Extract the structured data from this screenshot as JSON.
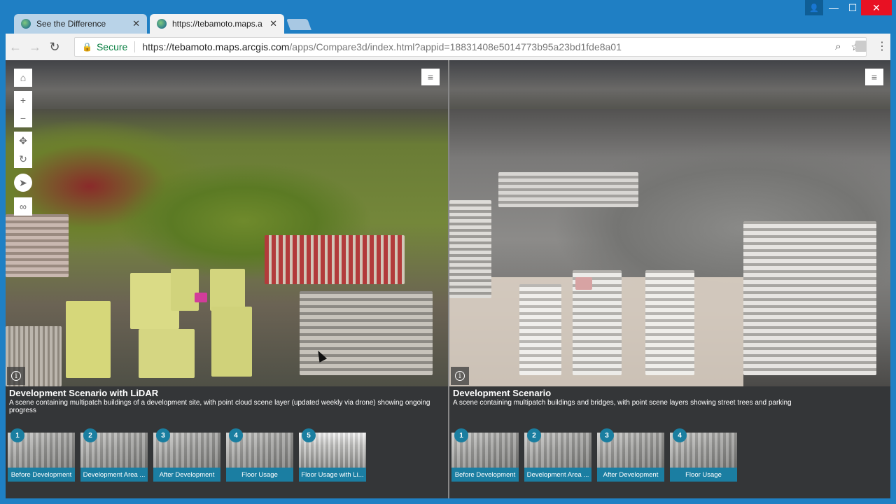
{
  "browser": {
    "tabs": [
      {
        "title": "See the Difference",
        "close": "✕"
      },
      {
        "title": "https://tebamoto.maps.a",
        "close": "✕"
      }
    ],
    "window_controls": {
      "user": "👤",
      "minimize": "—",
      "maximize": "☐",
      "close": "✕"
    },
    "nav": {
      "back": "←",
      "forward": "→",
      "reload": "↻"
    },
    "address": {
      "secure_label": "Secure",
      "scheme": "https://",
      "host": "tebamoto.maps.arcgis.com",
      "path": "/apps/Compare3d/index.html?appid=18831408e5014773b95a23bd1fde8a01"
    },
    "icons": {
      "lock": "lock-icon",
      "zoom": "magnifier-icon",
      "star": "star-icon",
      "menu": "kebab-menu-icon"
    }
  },
  "map_controls": {
    "home": "⌂",
    "zoom_in": "+",
    "zoom_out": "−",
    "pan": "✥",
    "rotate": "↻",
    "compass": "➤",
    "vr": "∞",
    "layer_list": "≡",
    "info": "i"
  },
  "left_pane": {
    "title": "Development Scenario with LiDAR",
    "description": "A scene containing multipatch buildings of a development site, with point cloud scene layer (updated weekly via drone) showing ongoing progress",
    "slides": [
      {
        "number": "1",
        "label": "Before Development"
      },
      {
        "number": "2",
        "label": "Development Area ..."
      },
      {
        "number": "3",
        "label": "After Development"
      },
      {
        "number": "4",
        "label": "Floor Usage"
      },
      {
        "number": "5",
        "label": "Floor Usage with Li..."
      }
    ]
  },
  "right_pane": {
    "title": "Development Scenario",
    "description": "A scene containing multipatch buildings and bridges, with point scene layers showing street trees and parking",
    "slides": [
      {
        "number": "1",
        "label": "Before Development"
      },
      {
        "number": "2",
        "label": "Development Area ..."
      },
      {
        "number": "3",
        "label": "After Development"
      },
      {
        "number": "4",
        "label": "Floor Usage"
      }
    ]
  },
  "colors": {
    "accent": "#1b7ea2",
    "browser_frame": "#1f7fc4",
    "close_red": "#e81123",
    "secure_green": "#0b8043"
  }
}
